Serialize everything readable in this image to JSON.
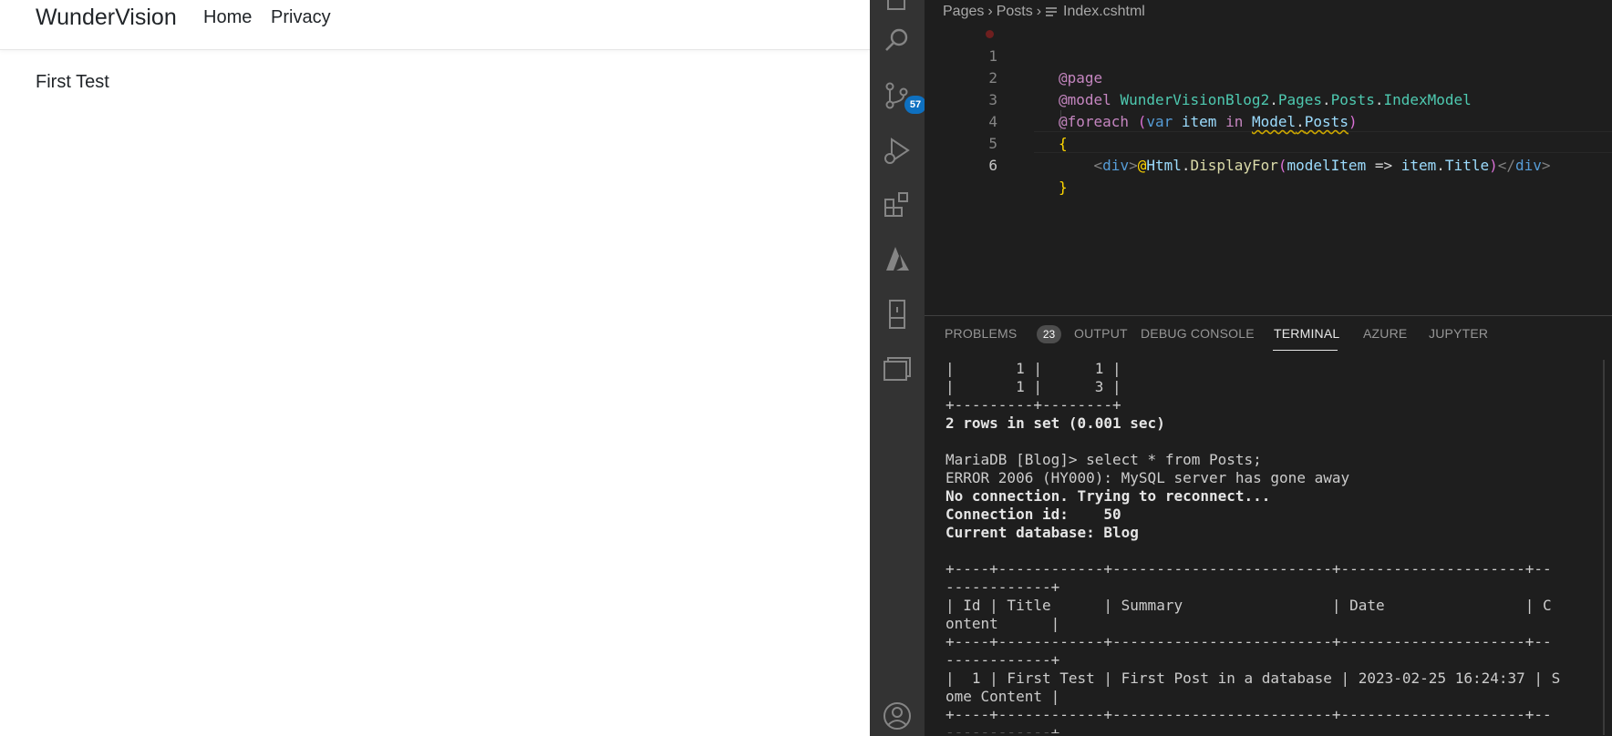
{
  "browser": {
    "brand": "WunderVision",
    "nav": {
      "home": "Home",
      "privacy": "Privacy"
    },
    "post_title": "First Test"
  },
  "vscode": {
    "activity_bar": {
      "items": [
        "explorer-icon",
        "search-icon",
        "source-control-icon",
        "run-debug-icon",
        "extensions-icon",
        "azure-icon",
        "remote-explorer-icon",
        "editor-groups-icon",
        "account-icon"
      ],
      "scm_badge": "57",
      "accent_color": "#0e70c0"
    },
    "breadcrumb": [
      "Pages",
      "Posts",
      "Index.cshtml"
    ],
    "editor": {
      "line_numbers": [
        "1",
        "2",
        "3",
        "4",
        "5",
        "6"
      ],
      "code": {
        "l1_dir": "@page",
        "l2_dir": "@model",
        "l2_ns1": "WunderVisionBlog2",
        "l2_ns2": "Pages",
        "l2_ns3": "Posts",
        "l2_ns4": "IndexModel",
        "l3_dir": "@foreach",
        "l3_var_kw": "var",
        "l3_item": "item",
        "l3_in": "in",
        "l3_model": "Model",
        "l3_posts": "Posts",
        "l4_brace": "{",
        "l5_div_open": "div",
        "l5_at": "@",
        "l5_html": "Html",
        "l5_display": "DisplayFor",
        "l5_param": "modelItem",
        "l5_arrow": "=>",
        "l5_item": "item",
        "l5_title": "Title",
        "l5_div_close": "div",
        "l6_brace": "}"
      }
    },
    "panel": {
      "tabs": [
        "PROBLEMS",
        "OUTPUT",
        "DEBUG CONSOLE",
        "TERMINAL",
        "AZURE",
        "JUPYTER"
      ],
      "active_tab": "TERMINAL",
      "problems_count": "23"
    },
    "terminal": {
      "lines": [
        {
          "text": "|       1 |      1 |",
          "bold": false
        },
        {
          "text": "|       1 |      3 |",
          "bold": false
        },
        {
          "text": "+---------+--------+",
          "bold": false
        },
        {
          "text": "2 rows in set (0.001 sec)",
          "bold": true
        },
        {
          "text": "",
          "bold": false
        },
        {
          "text": "MariaDB [Blog]> select * from Posts;",
          "bold": false
        },
        {
          "text": "ERROR 2006 (HY000): MySQL server has gone away",
          "bold": false
        },
        {
          "text": "No connection. Trying to reconnect...",
          "bold": true
        },
        {
          "text": "Connection id:    50",
          "bold": true
        },
        {
          "text": "Current database: Blog",
          "bold": true
        },
        {
          "text": "",
          "bold": false
        },
        {
          "text": "+----+------------+-------------------------+---------------------+--",
          "bold": false
        },
        {
          "text": "------------+",
          "bold": false
        },
        {
          "text": "| Id | Title      | Summary                 | Date                | C",
          "bold": false
        },
        {
          "text": "ontent      |",
          "bold": false
        },
        {
          "text": "+----+------------+-------------------------+---------------------+--",
          "bold": false
        },
        {
          "text": "------------+",
          "bold": false
        },
        {
          "text": "|  1 | First Test | First Post in a database | 2023-02-25 16:24:37 | S",
          "bold": false
        },
        {
          "text": "ome Content |",
          "bold": false
        },
        {
          "text": "+----+------------+-------------------------+---------------------+--",
          "bold": false
        },
        {
          "text": "------------+",
          "bold": false
        }
      ]
    }
  }
}
